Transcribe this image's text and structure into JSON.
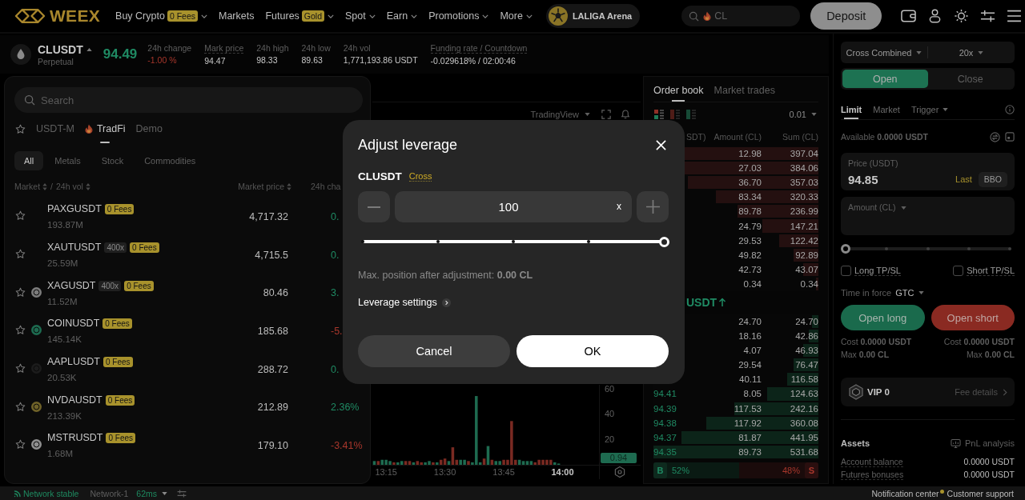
{
  "header": {
    "logo": "WEEX",
    "nav": [
      {
        "label": "Buy Crypto",
        "badge": "0 Fees",
        "dropdown": true
      },
      {
        "label": "Markets",
        "dropdown": false
      },
      {
        "label": "Futures",
        "badge": "Gold",
        "dropdown": true
      },
      {
        "label": "Spot",
        "dropdown": true
      },
      {
        "label": "Earn",
        "dropdown": true
      },
      {
        "label": "Promotions",
        "dropdown": true
      },
      {
        "label": "More",
        "dropdown": true
      }
    ],
    "promo": "LALIGA Arena",
    "search": {
      "placeholder": "CL",
      "hot": true
    },
    "deposit": "Deposit"
  },
  "ticker": {
    "symbol": "CLUSDT",
    "contract": "Perpetual",
    "price": "94.49",
    "rising": true,
    "stats": [
      {
        "label": "24h change",
        "value": "-1.00 %",
        "negative": true,
        "underlined": false
      },
      {
        "label": "Mark price",
        "value": "94.47",
        "negative": false,
        "underlined": true
      },
      {
        "label": "24h high",
        "value": "98.33",
        "negative": false,
        "underlined": false
      },
      {
        "label": "24h low",
        "value": "89.63",
        "negative": false,
        "underlined": false
      },
      {
        "label": "24h vol",
        "value": "1,771,193.86 USDT",
        "negative": false,
        "underlined": false
      },
      {
        "label": "Funding rate / Countdown",
        "value": "-0.029618% / 02:00:46",
        "negative": false,
        "underlined": true
      }
    ]
  },
  "market_panel": {
    "search": {
      "placeholder": "Search"
    },
    "tabs": [
      {
        "label": "USDT-M",
        "selected": false,
        "hot": false
      },
      {
        "label": "TradFi",
        "selected": true,
        "hot": true
      },
      {
        "label": "Demo",
        "selected": false,
        "hot": false
      }
    ],
    "filters": [
      {
        "label": "All",
        "selected": true
      },
      {
        "label": "Metals",
        "selected": false
      },
      {
        "label": "Stock",
        "selected": false
      },
      {
        "label": "Commodities",
        "selected": false
      }
    ],
    "columns": {
      "market": "Market",
      "separator": "/",
      "volume": "24h vol",
      "price": "Market price",
      "change": "24h cha"
    },
    "rows": [
      {
        "symbol": "PAXGUSDT",
        "starred": false,
        "badges": [
          {
            "text": "0 Fees",
            "kind": "fee"
          }
        ],
        "volume": "193.87M",
        "price": "4,717.32",
        "change": "0.",
        "negative": false
      },
      {
        "symbol": "XAUTUSDT",
        "starred": false,
        "badges": [
          {
            "text": "400x",
            "kind": "leverage"
          },
          {
            "text": "0 Fees",
            "kind": "fee"
          }
        ],
        "volume": "25.59M",
        "price": "4,715.5",
        "change": "0.",
        "negative": false
      },
      {
        "symbol": "XAGUSDT",
        "starred": false,
        "color": "#7c7c7c",
        "badges": [
          {
            "text": "400x",
            "kind": "leverage"
          },
          {
            "text": "0 Fees",
            "kind": "fee"
          }
        ],
        "volume": "11.52M",
        "price": "80.46",
        "change": "3.",
        "negative": false
      },
      {
        "symbol": "COINUSDT",
        "starred": false,
        "color": "#1d6b50",
        "badges": [
          {
            "text": "0 Fees",
            "kind": "fee"
          }
        ],
        "volume": "145.14K",
        "price": "185.68",
        "change": "-5.",
        "negative": true
      },
      {
        "symbol": "AAPLUSDT",
        "starred": false,
        "color": "#1c1c1c",
        "badges": [
          {
            "text": "0 Fees",
            "kind": "fee"
          }
        ],
        "volume": "20.53K",
        "price": "288.72",
        "change": "0.",
        "negative": false
      },
      {
        "symbol": "NVDAUSDT",
        "starred": false,
        "color": "#6f6228",
        "badges": [
          {
            "text": "0 Fees",
            "kind": "fee"
          }
        ],
        "volume": "213.39K",
        "price": "212.89",
        "change": "2.36%",
        "negative": false
      },
      {
        "symbol": "MSTRUSDT",
        "starred": false,
        "color": "#8f8f8f",
        "badges": [
          {
            "text": "0 Fees",
            "kind": "fee"
          }
        ],
        "volume": "1.68M",
        "price": "179.10",
        "change": "-3.41%",
        "negative": true
      }
    ]
  },
  "chart": {
    "provider": "TradingView",
    "value_tag": "0.94",
    "chart_data": {
      "type": "bar",
      "x": [
        792,
        793,
        794,
        795,
        796,
        797,
        798,
        799,
        800,
        801,
        802,
        803,
        804,
        805,
        806,
        807,
        808,
        809,
        810,
        811,
        812,
        813,
        814,
        815,
        816,
        817,
        818,
        819,
        820,
        821,
        822,
        823,
        824,
        825,
        826,
        827,
        828,
        829,
        830,
        831,
        832,
        833,
        834,
        835,
        836,
        837,
        838,
        839
      ],
      "series": [
        {
          "color": "#1e6b50",
          "values": [
            3,
            null,
            4,
            4,
            3,
            null,
            2,
            3,
            null,
            null,
            2,
            null,
            null,
            2,
            3,
            null,
            2,
            null,
            null,
            3,
            null,
            null,
            4,
            4,
            null,
            2,
            55,
            2,
            null,
            15,
            null,
            3,
            3,
            null,
            null,
            null,
            null,
            4,
            3,
            3,
            3,
            null,
            null,
            null,
            null,
            null,
            2,
            1
          ]
        },
        {
          "color": "#7a2a22",
          "values": [
            null,
            3,
            null,
            null,
            null,
            2,
            null,
            null,
            3,
            3,
            null,
            3,
            2,
            null,
            null,
            2,
            null,
            4,
            5,
            null,
            14,
            4,
            null,
            null,
            3,
            null,
            null,
            null,
            5,
            null,
            4,
            null,
            null,
            4,
            4,
            35,
            4,
            null,
            null,
            null,
            null,
            2,
            4,
            4,
            4,
            4,
            null,
            null
          ]
        }
      ],
      "xlim": [
        791.5,
        859.9
      ],
      "ylim": [
        0,
        64
      ],
      "yticks": [
        20,
        40,
        60
      ],
      "xticks": [
        {
          "value": 795,
          "label": "13:15"
        },
        {
          "value": 810,
          "label": "13:30"
        },
        {
          "value": 825,
          "label": "13:45"
        },
        {
          "value": 840,
          "label": "14:00"
        }
      ]
    }
  },
  "order_book": {
    "tabs": [
      {
        "label": "Order book",
        "selected": true
      },
      {
        "label": "Market trades",
        "selected": false
      }
    ],
    "views": [
      {
        "kind": "both",
        "selected": true
      },
      {
        "kind": "asks",
        "selected": false
      },
      {
        "kind": "bids",
        "selected": false
      }
    ],
    "precision": "0.01",
    "columns": {
      "price": "SDT)",
      "amount": "Amount (CL)",
      "sum": "Sum (CL)"
    },
    "asks": [
      {
        "amount": "12.98",
        "sum": "397.04",
        "level": 0.97
      },
      {
        "amount": "27.03",
        "sum": "384.06",
        "level": 0.93
      },
      {
        "amount": "36.70",
        "sum": "357.03",
        "level": 0.79
      },
      {
        "amount": "83.34",
        "sum": "320.33",
        "level": 0.62
      },
      {
        "amount": "89.78",
        "sum": "236.99",
        "level": 0.49
      },
      {
        "amount": "24.79",
        "sum": "147.21",
        "level": 0.34
      },
      {
        "amount": "29.53",
        "sum": "122.42",
        "level": 0.24
      },
      {
        "amount": "49.82",
        "sum": "92.89",
        "level": 0.15
      },
      {
        "amount": "42.73",
        "sum": "43.07",
        "level": 0.09
      },
      {
        "amount": "0.34",
        "sum": "0.34",
        "level": 0.015
      }
    ],
    "mid": {
      "text": "USDT",
      "rising": true
    },
    "bids": [
      {
        "amount": "24.70",
        "sum": "24.70",
        "level": 0.04
      },
      {
        "amount": "18.16",
        "sum": "42.86",
        "level": 0.06
      },
      {
        "amount": "4.07",
        "sum": "46.93",
        "level": 0.09
      },
      {
        "amount": "29.54",
        "sum": "76.47",
        "level": 0.15
      },
      {
        "amount": "40.11",
        "sum": "116.58",
        "level": 0.19
      },
      {
        "price": "94.41",
        "amount": "8.05",
        "sum": "124.63",
        "level": 0.31
      },
      {
        "price": "94.39",
        "amount": "117.53",
        "sum": "242.16",
        "level": 0.51
      },
      {
        "price": "94.38",
        "amount": "117.92",
        "sum": "360.08",
        "level": 0.68
      },
      {
        "price": "94.37",
        "amount": "81.87",
        "sum": "441.95",
        "level": 0.83
      },
      {
        "price": "94.35",
        "amount": "89.73",
        "sum": "531.68",
        "level": 1
      }
    ],
    "ratio": {
      "buy_tag": "B",
      "buy": "52%",
      "sell": "48%",
      "sell_tag": "S",
      "level": 0.52
    }
  },
  "order_form": {
    "margin_mode": "Cross Combined",
    "leverage": "20x",
    "sides": [
      {
        "label": "Open",
        "selected": true
      },
      {
        "label": "Close",
        "selected": false
      }
    ],
    "order_types": [
      {
        "label": "Limit",
        "selected": true,
        "dropdown": false
      },
      {
        "label": "Market",
        "selected": false,
        "dropdown": false
      },
      {
        "label": "Trigger",
        "selected": false,
        "dropdown": true
      }
    ],
    "available": "Available **0.0000 USDT**",
    "price": {
      "label": "Price (USDT)",
      "value": "94.85",
      "last": "Last",
      "bbo": "BBO"
    },
    "amount": {
      "label": "Amount (CL)"
    },
    "slider": {
      "level": 0
    },
    "tpsl": [
      {
        "label": "Long TP/SL",
        "checked": false
      },
      {
        "label": "Short TP/SL",
        "checked": false
      }
    ],
    "time_in_force": {
      "label": "Time in force",
      "value": "GTC"
    },
    "actions": [
      {
        "label": "Open long",
        "kind": "long"
      },
      {
        "label": "Open short",
        "kind": "short"
      }
    ],
    "costs": [
      {
        "cost": "Cost **0.0000 USDT**",
        "max": "Max **0.00 CL**"
      },
      {
        "cost": "Cost **0.0000 USDT**",
        "max": "Max **0.00 CL**"
      }
    ],
    "vip": {
      "tier": "VIP 0",
      "link": "Fee details"
    },
    "assets": {
      "title": "Assets",
      "link": "PnL analysis",
      "rows": [
        {
          "label": "Account balance",
          "value": "0.0000 USDT"
        },
        {
          "label": "Futures bonuses",
          "value": "0.0000 USDT"
        }
      ]
    }
  },
  "status_bar": {
    "network_status": "Network stable",
    "network": "Network-1",
    "latency": "62ms",
    "links": [
      {
        "label": "Notification center",
        "unread": true
      },
      {
        "label": "Customer support",
        "unread": false
      }
    ]
  },
  "modal": {
    "title": "Adjust leverage",
    "symbol": "CLUSDT",
    "mode": "Cross",
    "value": "100",
    "unit": "x",
    "slider": {
      "level": 1
    },
    "max_position": "Max. position after adjustment: **0.00 CL**",
    "settings_link": "Leverage settings",
    "buttons": [
      {
        "label": "Cancel",
        "kind": "secondary"
      },
      {
        "label": "OK",
        "kind": "primary"
      }
    ]
  }
}
